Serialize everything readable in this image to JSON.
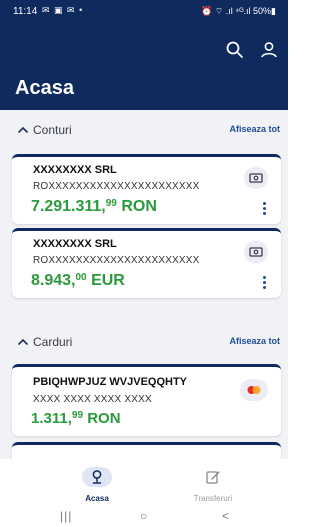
{
  "status_bar": {
    "time": "11:14",
    "left_icons": "✉ ▣ ✉ •",
    "right_text": "⏰ ⌔ .ıl ⁴ᴳ.ıl 50%▮"
  },
  "header": {
    "title": "Acasa"
  },
  "accounts_section": {
    "title": "Conturi",
    "action": "Afiseaza tot"
  },
  "accounts": [
    {
      "name": "XXXXXXXX SRL",
      "iban": "ROXXXXXXXXXXXXXXXXXXXXXX",
      "amount_int": "7.291.311,",
      "amount_dec": "99",
      "currency": "RON"
    },
    {
      "name": "XXXXXXXX SRL",
      "iban": "ROXXXXXXXXXXXXXXXXXXXXXX",
      "amount_int": "8.943,",
      "amount_dec": "00",
      "currency": "EUR"
    }
  ],
  "cards_section": {
    "title": "Carduri",
    "action": "Afiseaza tot"
  },
  "cards": [
    {
      "name": "PBIQHWPJUZ WVJVEQQHTY",
      "number": "XXXX XXXX XXXX XXXX",
      "amount_int": "1.311,",
      "amount_dec": "99",
      "currency": "RON"
    }
  ],
  "bottom_nav": {
    "items": [
      {
        "label": "Acasa",
        "active": true
      },
      {
        "label": "Transferuri",
        "active": false
      }
    ]
  },
  "system_nav": {
    "recents": "|||",
    "home": "○",
    "back": "<"
  },
  "colors": {
    "header_bg": "#0f2b5e",
    "content_bg": "#f1f2f6",
    "balance_green": "#2a9a3c",
    "link_blue": "#1f4f96"
  }
}
